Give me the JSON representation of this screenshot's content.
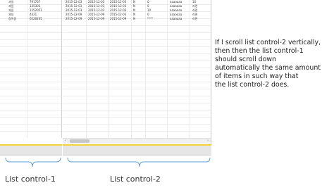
{
  "list_control_1": {
    "rows": [
      [
        "과일",
        "791767"
      ],
      [
        "과일",
        "135302"
      ],
      [
        "과일",
        "1552051"
      ],
      [
        "과일",
        "4321"
      ],
      [
        "장독좋",
        "6226205"
      ]
    ]
  },
  "list_control_2": {
    "rows": [
      [
        "2015-12-03",
        "2015-12-03",
        "2015-12-03",
        "N",
        "0",
        "aaaaaaa",
        "10"
      ],
      [
        "2015-12-03",
        "2015-12-03",
        "2015-12-03",
        "N",
        "0",
        "aaaaaaa",
        "라면"
      ],
      [
        "2015-12-03",
        "2015-12-03",
        "2015-12-03",
        "N",
        "10",
        "aaaaaaa",
        "라면"
      ],
      [
        "2015-12-09",
        "2015-12-09",
        "2015-12-03",
        "N",
        "0",
        "aaaaaaa",
        "라면"
      ],
      [
        "2015-12-09",
        "2015-12-09",
        "2015-12-09",
        "N",
        "****",
        "aaaaaaa",
        "라면"
      ]
    ]
  },
  "scrollbar": {
    "left_arrow": "‹",
    "right_arrow": "›"
  },
  "labels": {
    "list_control_1": "List control-1",
    "list_control_2": "List control-2"
  },
  "note_lines": [
    "If I scroll list control-2 vertically,",
    "then then the list control-1",
    "should scroll down",
    "automatically the same amount",
    "of items in such way that",
    "the list control-2 does."
  ],
  "colors": {
    "highlight": "#f3d23a",
    "brace": "#5b9bd5"
  }
}
